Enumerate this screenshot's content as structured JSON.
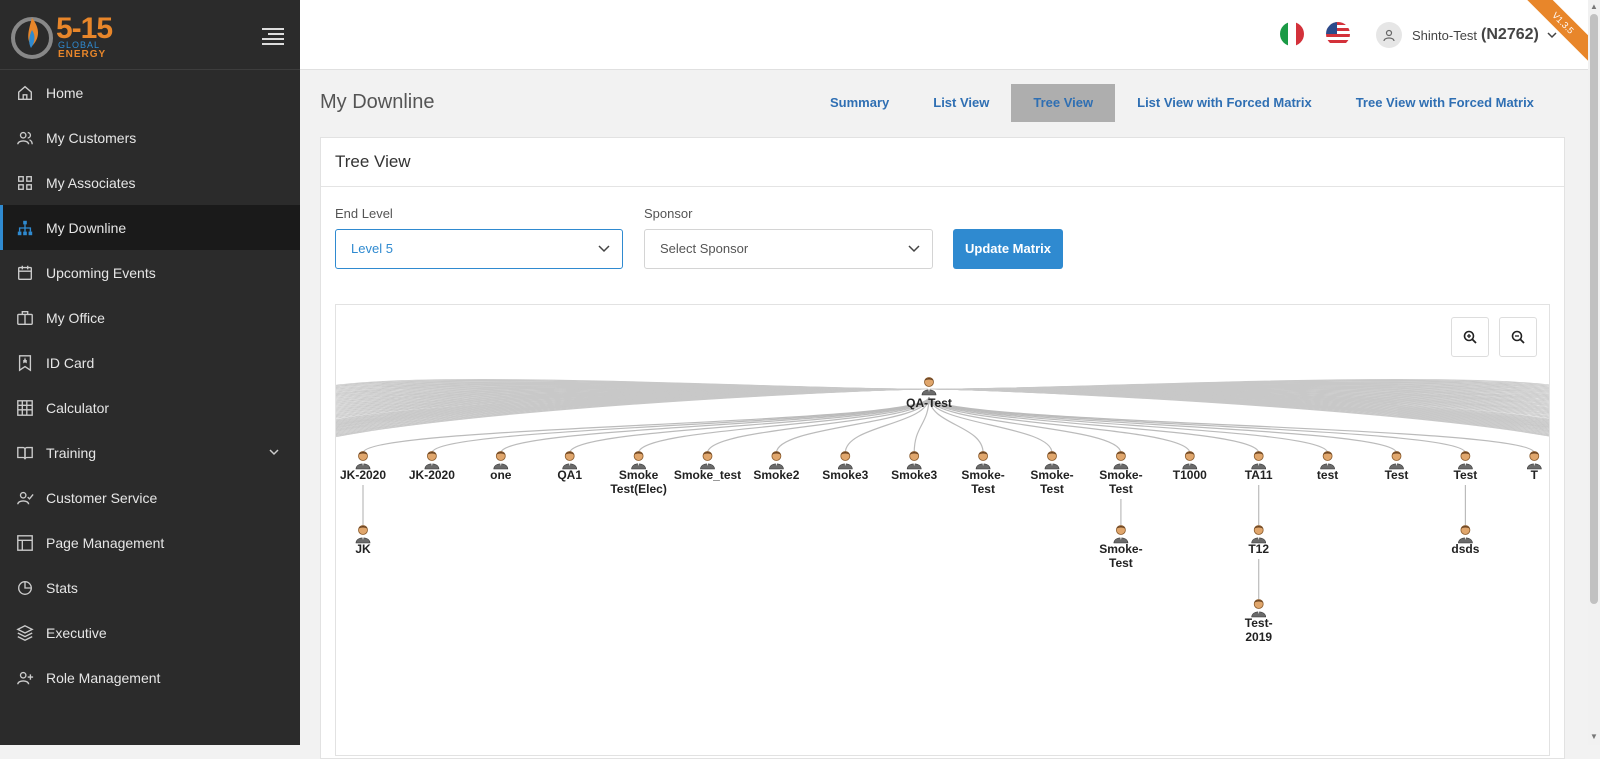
{
  "logo": {
    "main": "5-15",
    "sub1": "GLOBAL",
    "sub2": "ENERGY",
    "version": "V1.3.5"
  },
  "sidebar": {
    "items": [
      {
        "label": "Home",
        "icon": "home-icon"
      },
      {
        "label": "My Customers",
        "icon": "users-icon"
      },
      {
        "label": "My Associates",
        "icon": "grid-icon"
      },
      {
        "label": "My Downline",
        "icon": "hierarchy-icon",
        "active": true
      },
      {
        "label": "Upcoming Events",
        "icon": "calendar-icon"
      },
      {
        "label": "My Office",
        "icon": "briefcase-icon"
      },
      {
        "label": "ID Card",
        "icon": "badge-icon"
      },
      {
        "label": "Calculator",
        "icon": "calculator-icon"
      },
      {
        "label": "Training",
        "icon": "book-icon",
        "expandable": true
      },
      {
        "label": "Customer Service",
        "icon": "user-check-icon"
      },
      {
        "label": "Page Management",
        "icon": "layout-icon"
      },
      {
        "label": "Stats",
        "icon": "pie-chart-icon"
      },
      {
        "label": "Executive",
        "icon": "layers-icon"
      },
      {
        "label": "Role Management",
        "icon": "user-plus-icon"
      }
    ]
  },
  "header": {
    "user_name": "Shinto-Test",
    "user_id": "(N2762)",
    "flags": [
      "italy-flag-icon",
      "usa-flag-icon"
    ]
  },
  "page": {
    "title": "My Downline",
    "tabs": [
      {
        "label": "Summary"
      },
      {
        "label": "List View"
      },
      {
        "label": "Tree View",
        "active": true
      },
      {
        "label": "List View with Forced Matrix"
      },
      {
        "label": "Tree View with Forced Matrix"
      }
    ]
  },
  "card": {
    "title": "Tree View",
    "end_level_label": "End Level",
    "end_level_value": "Level 5",
    "sponsor_label": "Sponsor",
    "sponsor_value": "Select Sponsor",
    "update_button": "Update Matrix"
  },
  "tree": {
    "root": "QA-Test",
    "children": [
      {
        "label": [
          "JK-2020"
        ],
        "children": [
          {
            "label": [
              "JK"
            ]
          }
        ]
      },
      {
        "label": [
          "JK-2020"
        ]
      },
      {
        "label": [
          "one"
        ]
      },
      {
        "label": [
          "QA1"
        ]
      },
      {
        "label": [
          "Smoke",
          "Test(Elec)"
        ]
      },
      {
        "label": [
          "Smoke_test"
        ]
      },
      {
        "label": [
          "Smoke2"
        ]
      },
      {
        "label": [
          "Smoke3"
        ]
      },
      {
        "label": [
          "Smoke3"
        ]
      },
      {
        "label": [
          "Smoke-",
          "Test"
        ]
      },
      {
        "label": [
          "Smoke-",
          "Test"
        ]
      },
      {
        "label": [
          "Smoke-",
          "Test"
        ],
        "children": [
          {
            "label": [
              "Smoke-",
              "Test"
            ]
          }
        ]
      },
      {
        "label": [
          "T1000"
        ]
      },
      {
        "label": [
          "TA11"
        ],
        "children": [
          {
            "label": [
              "T12"
            ],
            "children": [
              {
                "label": [
                  "Test-",
                  "2019"
                ]
              }
            ]
          }
        ]
      },
      {
        "label": [
          "test"
        ]
      },
      {
        "label": [
          "Test"
        ]
      },
      {
        "label": [
          "Test"
        ],
        "children": [
          {
            "label": [
              "dsds"
            ]
          }
        ]
      },
      {
        "label": [
          "T"
        ]
      }
    ]
  },
  "colors": {
    "sidebar_bg": "#2b2b2b",
    "accent": "#2f8ad0",
    "brand_orange": "#e8862a",
    "tab_active_bg": "#aeaeae"
  }
}
